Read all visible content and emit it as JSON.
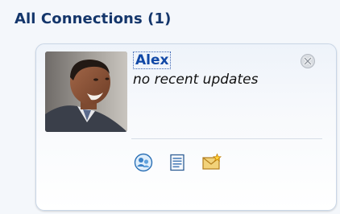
{
  "header": {
    "title": "All Connections",
    "count": "(1)"
  },
  "connection": {
    "name": "Alex",
    "status": "no recent updates",
    "actions": [
      {
        "icon": "people-icon"
      },
      {
        "icon": "document-icon"
      },
      {
        "icon": "mail-icon"
      }
    ],
    "close_icon": "close-icon"
  },
  "colors": {
    "header_text": "#14366b",
    "link": "#1148a6",
    "card_border": "#c9d6e6"
  }
}
